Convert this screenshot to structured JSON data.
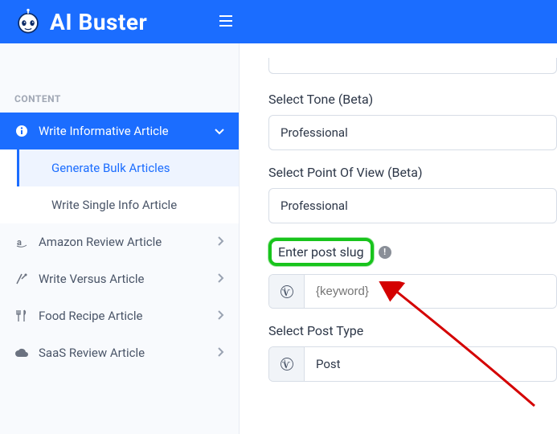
{
  "header": {
    "brand": "AI Buster"
  },
  "sidebar": {
    "section_label": "CONTENT",
    "active": {
      "label": "Write Informative Article"
    },
    "submenu": [
      {
        "label": "Generate Bulk Articles",
        "selected": true
      },
      {
        "label": "Write Single Info Article",
        "selected": false
      }
    ],
    "items": [
      {
        "label": "Amazon Review Article",
        "icon": "amazon"
      },
      {
        "label": "Write Versus Article",
        "icon": "versus"
      },
      {
        "label": "Food Recipe Article",
        "icon": "food"
      },
      {
        "label": "SaaS Review Article",
        "icon": "cloud"
      }
    ]
  },
  "form": {
    "tone": {
      "label": "Select Tone (Beta)",
      "value": "Professional"
    },
    "pov": {
      "label": "Select Point Of View (Beta)",
      "value": "Professional"
    },
    "slug": {
      "label": "Enter post slug",
      "placeholder": "{keyword}"
    },
    "post_type": {
      "label": "Select Post Type",
      "value": "Post"
    }
  },
  "colors": {
    "primary": "#1b6dff",
    "highlight": "#18c41c",
    "arrow": "#d40000"
  }
}
